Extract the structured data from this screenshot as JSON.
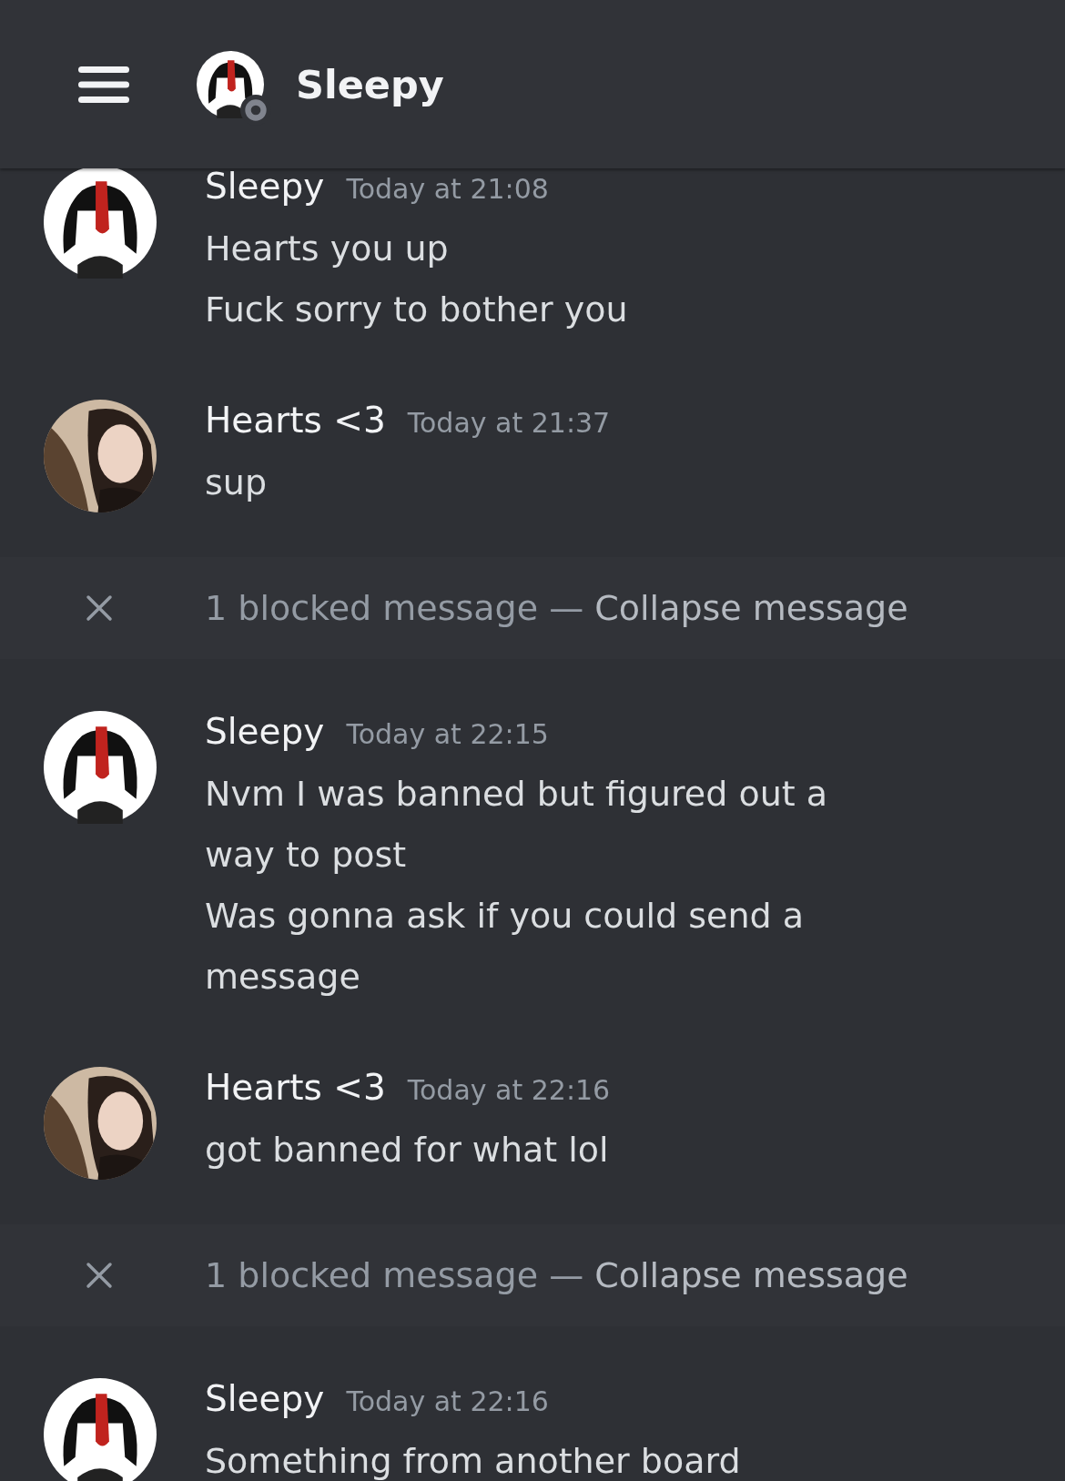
{
  "header": {
    "title": "Sleepy",
    "online": false
  },
  "items": [
    {
      "kind": "group",
      "author": "Sleepy",
      "timestamp": "Today at 21:08",
      "messages": [
        "Hearts you up",
        "Fuck sorry to bother you"
      ]
    },
    {
      "kind": "group",
      "author": "Hearts <3",
      "timestamp": "Today at 21:37",
      "messages": [
        "sup"
      ]
    },
    {
      "kind": "blocked",
      "text": "1 blocked message —",
      "link": "Collapse message"
    },
    {
      "kind": "group",
      "author": "Sleepy",
      "timestamp": "Today at 22:15",
      "messages": [
        "Nvm I was banned but figured out a way to post",
        "Was gonna ask if you could send a message"
      ]
    },
    {
      "kind": "group",
      "author": "Hearts <3",
      "timestamp": "Today at 22:16",
      "messages": [
        "got banned for what lol"
      ]
    },
    {
      "kind": "blocked",
      "text": "1 blocked message —",
      "link": "Collapse message"
    },
    {
      "kind": "group",
      "author": "Sleepy",
      "timestamp": "Today at 22:16",
      "messages": [
        "Something from another board"
      ]
    }
  ]
}
